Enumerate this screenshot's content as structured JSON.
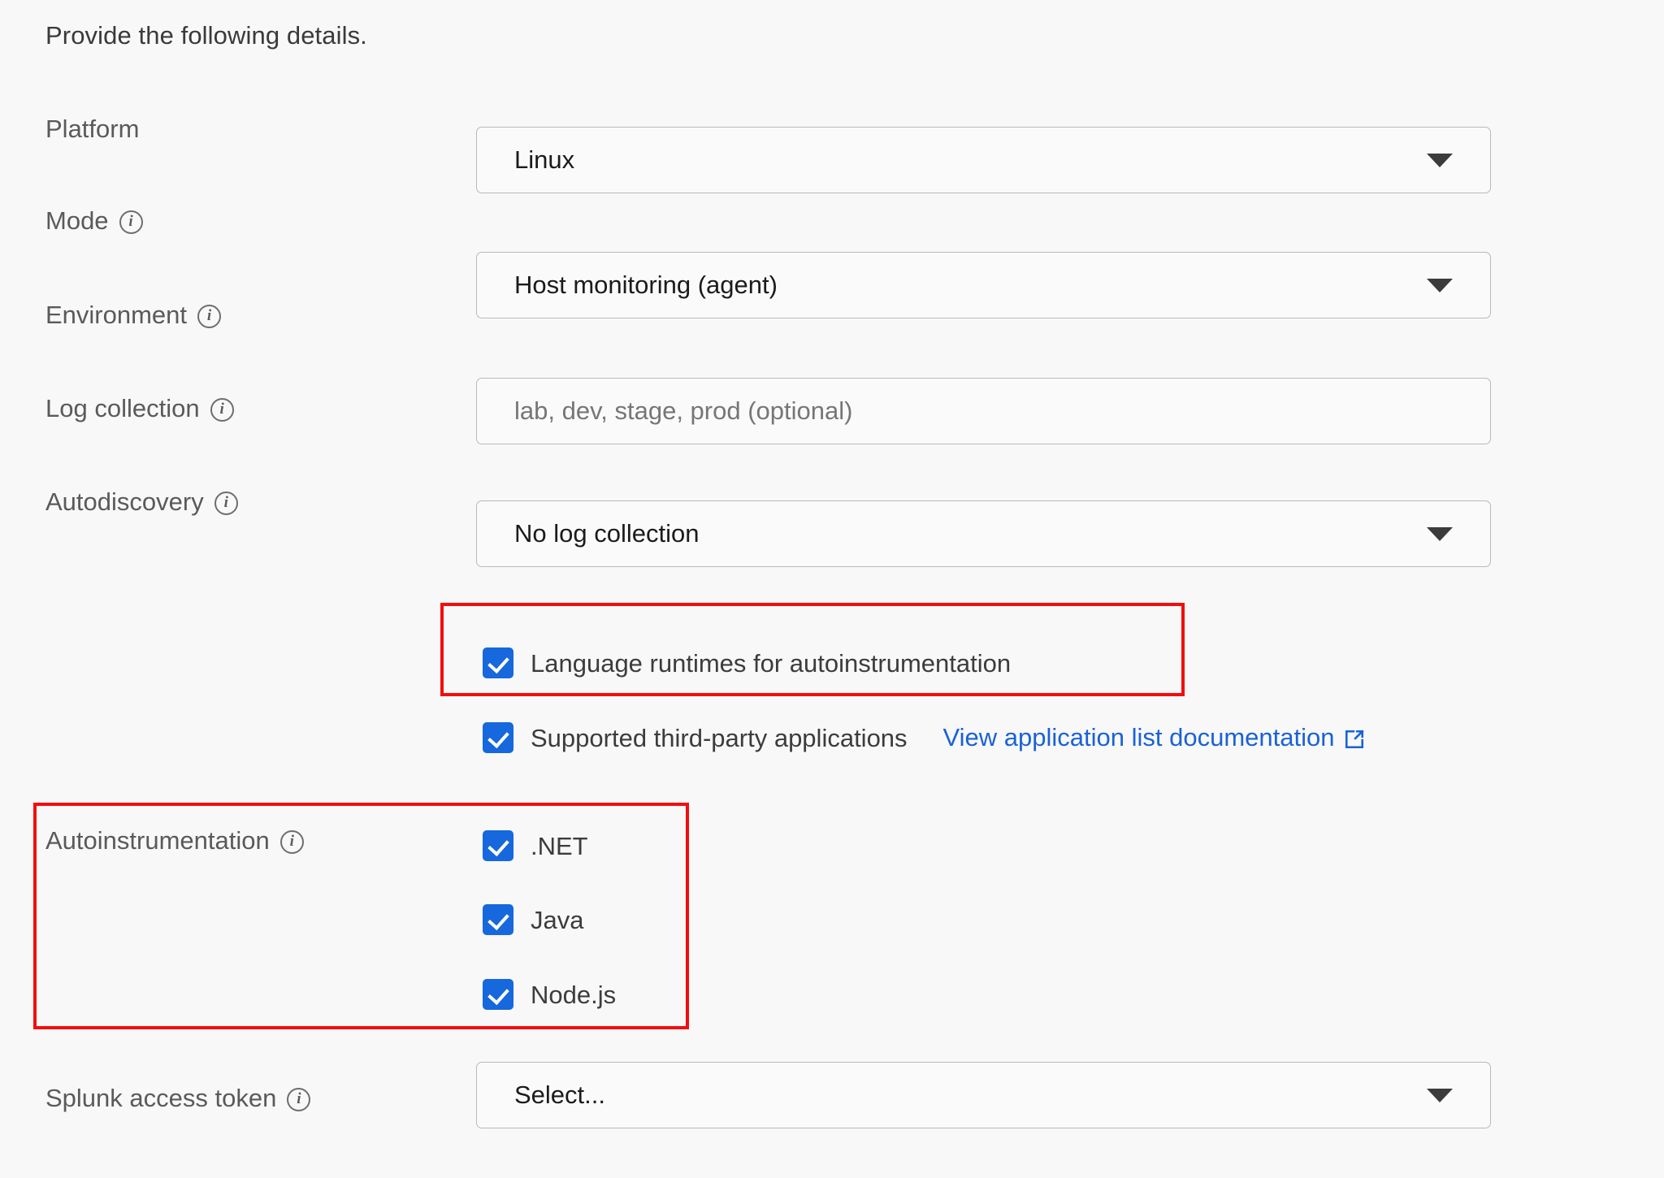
{
  "intro": {
    "text": "Provide the following details."
  },
  "icons": {
    "info": "info-icon",
    "caret": "chevron-down-icon",
    "external": "external-link-icon",
    "check": "checkmark-icon"
  },
  "colors": {
    "accent_blue": "#1668dc",
    "link_blue": "#1a62d6",
    "highlight_red": "#f40d0d",
    "background": "#f8f8f8",
    "field_border": "#b9b9b9",
    "label_text": "#5a5a5a"
  },
  "fields": {
    "platform": {
      "label": "Platform",
      "has_info": false,
      "value": "Linux",
      "type": "select"
    },
    "mode": {
      "label": "Mode",
      "has_info": true,
      "value": "Host monitoring (agent)",
      "type": "select"
    },
    "environment": {
      "label": "Environment",
      "has_info": true,
      "value": "",
      "placeholder": "lab, dev, stage, prod (optional)",
      "type": "text"
    },
    "log_collection": {
      "label": "Log collection",
      "has_info": true,
      "value": "No log collection",
      "type": "select"
    },
    "autodiscovery": {
      "label": "Autodiscovery",
      "has_info": true,
      "options": [
        {
          "label": "Language runtimes for autoinstrumentation",
          "checked": true
        },
        {
          "label": "Supported third-party applications",
          "checked": true
        }
      ],
      "link": {
        "text": "View application list documentation",
        "icon": "external-link-icon"
      }
    },
    "autoinstrumentation": {
      "label": "Autoinstrumentation",
      "has_info": true,
      "options": [
        {
          "label": ".NET",
          "checked": true
        },
        {
          "label": "Java",
          "checked": true
        },
        {
          "label": "Node.js",
          "checked": true
        }
      ]
    },
    "splunk_access_token": {
      "label": "Splunk access token",
      "has_info": true,
      "value": "Select...",
      "type": "select"
    }
  },
  "annotations": {
    "highlight_1": "Language runtimes for autoinstrumentation checkbox",
    "highlight_2": "Autoinstrumentation language selection group"
  }
}
